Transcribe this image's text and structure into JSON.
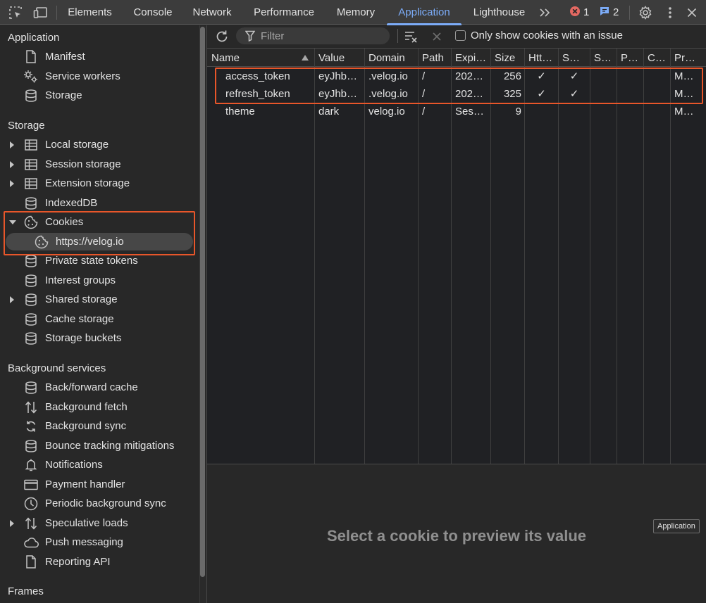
{
  "topbar": {
    "tabs": [
      {
        "label": "Elements"
      },
      {
        "label": "Console"
      },
      {
        "label": "Network"
      },
      {
        "label": "Performance"
      },
      {
        "label": "Memory"
      },
      {
        "label": "Application"
      },
      {
        "label": "Lighthouse"
      }
    ],
    "active_tab": "Application",
    "error_count": "1",
    "message_count": "2",
    "icons": [
      "inspect-element-icon",
      "device-toolbar-icon",
      "more-tabs-icon",
      "error-icon",
      "message-icon",
      "settings-gear-icon",
      "kebab-menu-icon",
      "close-icon"
    ]
  },
  "sidebar": {
    "application": {
      "header": "Application",
      "items": [
        {
          "label": "Manifest",
          "icon": "file-icon"
        },
        {
          "label": "Service workers",
          "icon": "gears-icon"
        },
        {
          "label": "Storage",
          "icon": "database-icon"
        }
      ]
    },
    "storage": {
      "header": "Storage",
      "items": [
        {
          "label": "Local storage",
          "icon": "table-icon",
          "expandable": true
        },
        {
          "label": "Session storage",
          "icon": "table-icon",
          "expandable": true
        },
        {
          "label": "Extension storage",
          "icon": "table-icon",
          "expandable": true
        },
        {
          "label": "IndexedDB",
          "icon": "database-icon"
        },
        {
          "label": "Cookies",
          "icon": "cookie-icon",
          "expanded": true
        },
        {
          "label": "https://velog.io",
          "icon": "cookie-icon",
          "selected": true
        },
        {
          "label": "Private state tokens",
          "icon": "database-icon"
        },
        {
          "label": "Interest groups",
          "icon": "database-icon"
        },
        {
          "label": "Shared storage",
          "icon": "database-icon",
          "expandable": true
        },
        {
          "label": "Cache storage",
          "icon": "database-icon"
        },
        {
          "label": "Storage buckets",
          "icon": "database-icon"
        }
      ]
    },
    "background": {
      "header": "Background services",
      "items": [
        {
          "label": "Back/forward cache",
          "icon": "database-icon"
        },
        {
          "label": "Background fetch",
          "icon": "updown-arrows-icon"
        },
        {
          "label": "Background sync",
          "icon": "sync-icon"
        },
        {
          "label": "Bounce tracking mitigations",
          "icon": "database-icon"
        },
        {
          "label": "Notifications",
          "icon": "bell-icon"
        },
        {
          "label": "Payment handler",
          "icon": "credit-card-icon"
        },
        {
          "label": "Periodic background sync",
          "icon": "clock-icon"
        },
        {
          "label": "Speculative loads",
          "icon": "updown-arrows-icon",
          "expandable": true
        },
        {
          "label": "Push messaging",
          "icon": "cloud-icon"
        },
        {
          "label": "Reporting API",
          "icon": "file-icon"
        }
      ]
    },
    "frames": {
      "header": "Frames"
    }
  },
  "toolbar": {
    "filter_placeholder": "Filter",
    "only_issues_label": "Only show cookies with an issue",
    "only_issues_checked": false
  },
  "cookies_table": {
    "columns": [
      "Name",
      "Value",
      "Domain",
      "Path",
      "Expi…",
      "Size",
      "Htt…",
      "S…",
      "S…",
      "P…",
      "C…",
      "Pr…"
    ],
    "sort_column": "Name",
    "sort_direction": "ascending",
    "rows": [
      {
        "name": "access_token",
        "value": "eyJhb…",
        "domain": ".velog.io",
        "path": "/",
        "expires": "202…",
        "size": "256",
        "httponly": "✓",
        "secure": "✓",
        "samesite": "",
        "partition": "",
        "crosssite": "",
        "priority": "M…"
      },
      {
        "name": "refresh_token",
        "value": "eyJhb…",
        "domain": ".velog.io",
        "path": "/",
        "expires": "202…",
        "size": "325",
        "httponly": "✓",
        "secure": "✓",
        "samesite": "",
        "partition": "",
        "crosssite": "",
        "priority": "M…"
      },
      {
        "name": "theme",
        "value": "dark",
        "domain": "velog.io",
        "path": "/",
        "expires": "Ses…",
        "size": "9",
        "httponly": "",
        "secure": "",
        "samesite": "",
        "partition": "",
        "crosssite": "",
        "priority": "M…"
      }
    ]
  },
  "preview": {
    "empty_message": "Select a cookie to preview its value"
  },
  "tooltip": {
    "text": "Application"
  },
  "colors": {
    "accent": "#7cacf8",
    "highlight_box": "#e8562a",
    "error": "#f28b82"
  }
}
